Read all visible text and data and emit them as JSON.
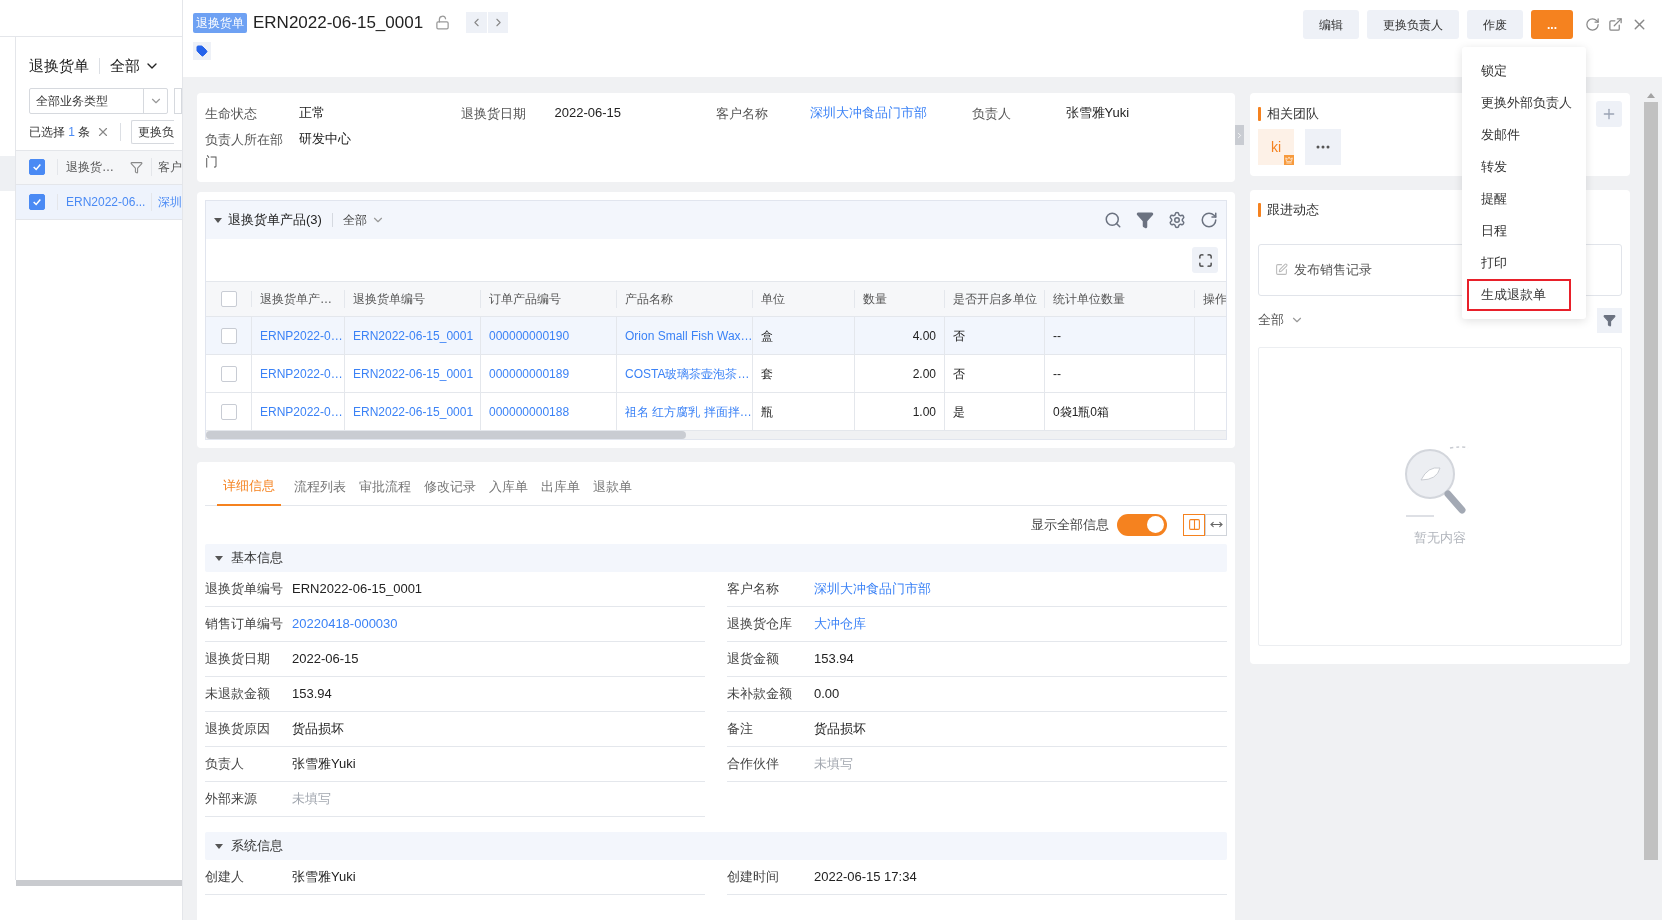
{
  "list_page": {
    "title": "退换货单",
    "view": "全部",
    "business_type": "全部业务类型",
    "selection": {
      "prefix": "已选择",
      "count": "1",
      "suffix": "条"
    },
    "batch_button": "更换负",
    "header_checked": true,
    "columns": [
      "退换货…",
      "客户"
    ],
    "rows": [
      {
        "selected": true,
        "cells": [
          "ERN2022-06...",
          "深圳"
        ]
      }
    ]
  },
  "drawer": {
    "tag": "退换货单",
    "title": "ERN2022-06-15_0001",
    "actions": [
      {
        "label": "编辑",
        "kind": "plain"
      },
      {
        "label": "更换负责人",
        "kind": "plain"
      },
      {
        "label": "作废",
        "kind": "plain"
      },
      {
        "label": "...",
        "kind": "primary"
      }
    ],
    "more_menu": [
      {
        "label": "锁定",
        "selected": false
      },
      {
        "label": "更换外部负责人",
        "selected": false
      },
      {
        "label": "发邮件",
        "selected": false
      },
      {
        "label": "转发",
        "selected": false
      },
      {
        "label": "提醒",
        "selected": false
      },
      {
        "label": "日程",
        "selected": false
      },
      {
        "label": "打印",
        "selected": false
      },
      {
        "label": "生成退款单",
        "selected": true
      }
    ],
    "summary": [
      {
        "label": "生命状态",
        "value": "正常",
        "kind": "text"
      },
      {
        "label": "退换货日期",
        "value": "2022-06-15",
        "kind": "text"
      },
      {
        "label": "客户名称",
        "value": "深圳大冲食品门市部",
        "kind": "link"
      },
      {
        "label": "负责人",
        "value": "张雪雅Yuki",
        "kind": "text"
      },
      {
        "label": "负责人所在部门",
        "value": "研发中心",
        "kind": "text"
      }
    ],
    "products": {
      "title": "退换货单产品(3)",
      "filter": "全部",
      "header_checked": false,
      "columns": [
        "退换货单产…",
        "退换货单编号",
        "订单产品编号",
        "产品名称",
        "单位",
        "数量",
        "是否开启多单位",
        "统计单位数量",
        "操作"
      ],
      "rows": [
        {
          "checked": false,
          "highlighted": true,
          "cells": [
            "ERNP2022-0…",
            "ERN2022-06-15_0001",
            "000000000190",
            "Orion Small Fish Wax…",
            "盒",
            "4.00",
            "否",
            "--",
            ""
          ]
        },
        {
          "checked": false,
          "highlighted": false,
          "cells": [
            "ERNP2022-0…",
            "ERN2022-06-15_0001",
            "000000000189",
            "COSTA玻璃茶壶泡茶…",
            "套",
            "2.00",
            "否",
            "--",
            ""
          ]
        },
        {
          "checked": false,
          "highlighted": false,
          "cells": [
            "ERNP2022-0…",
            "ERN2022-06-15_0001",
            "000000000188",
            "祖名 红方腐乳 拌面拌…",
            "瓶",
            "1.00",
            "是",
            "0袋1瓶0箱",
            ""
          ]
        }
      ]
    },
    "tabs": [
      {
        "label": "详细信息",
        "selected": true
      },
      {
        "label": "流程列表",
        "selected": false
      },
      {
        "label": "审批流程",
        "selected": false
      },
      {
        "label": "修改记录",
        "selected": false
      },
      {
        "label": "入库单",
        "selected": false
      },
      {
        "label": "出库单",
        "selected": false
      },
      {
        "label": "退款单",
        "selected": false
      }
    ],
    "show_all": {
      "label": "显示全部信息",
      "on": true
    },
    "layout_buttons": [
      {
        "kind": "two-column",
        "selected": true
      },
      {
        "kind": "one-column",
        "selected": false
      }
    ],
    "sections": [
      {
        "title": "基本信息",
        "fields": [
          {
            "label": "退换货单编号",
            "value": "ERN2022-06-15_0001",
            "kind": "text"
          },
          {
            "label": "客户名称",
            "value": "深圳大冲食品门市部",
            "kind": "link"
          },
          {
            "label": "销售订单编号",
            "value": "20220418-000030",
            "kind": "link"
          },
          {
            "label": "退换货仓库",
            "value": "大冲仓库",
            "kind": "link"
          },
          {
            "label": "退换货日期",
            "value": "2022-06-15",
            "kind": "text"
          },
          {
            "label": "退货金额",
            "value": "153.94",
            "kind": "text"
          },
          {
            "label": "未退款金额",
            "value": "153.94",
            "kind": "text"
          },
          {
            "label": "未补款金额",
            "value": "0.00",
            "kind": "text"
          },
          {
            "label": "退换货原因",
            "value": "货品损坏",
            "kind": "text"
          },
          {
            "label": "备注",
            "value": "货品损坏",
            "kind": "text"
          },
          {
            "label": "负责人",
            "value": "张雪雅Yuki",
            "kind": "text"
          },
          {
            "label": "合作伙伴",
            "value": "未填写",
            "kind": "empty"
          },
          {
            "label": "外部来源",
            "value": "未填写",
            "kind": "empty"
          }
        ]
      },
      {
        "title": "系统信息",
        "fields": [
          {
            "label": "创建人",
            "value": "张雪雅Yuki",
            "kind": "text"
          },
          {
            "label": "创建时间",
            "value": "2022-06-15 17:34",
            "kind": "text"
          }
        ]
      }
    ],
    "team": {
      "title": "相关团队",
      "members": [
        {
          "initials": "ki",
          "owner": true
        }
      ]
    },
    "follow": {
      "title": "跟进动态",
      "composer": "发布销售记录",
      "filter": "全部",
      "empty_text": "暂无内容"
    }
  }
}
